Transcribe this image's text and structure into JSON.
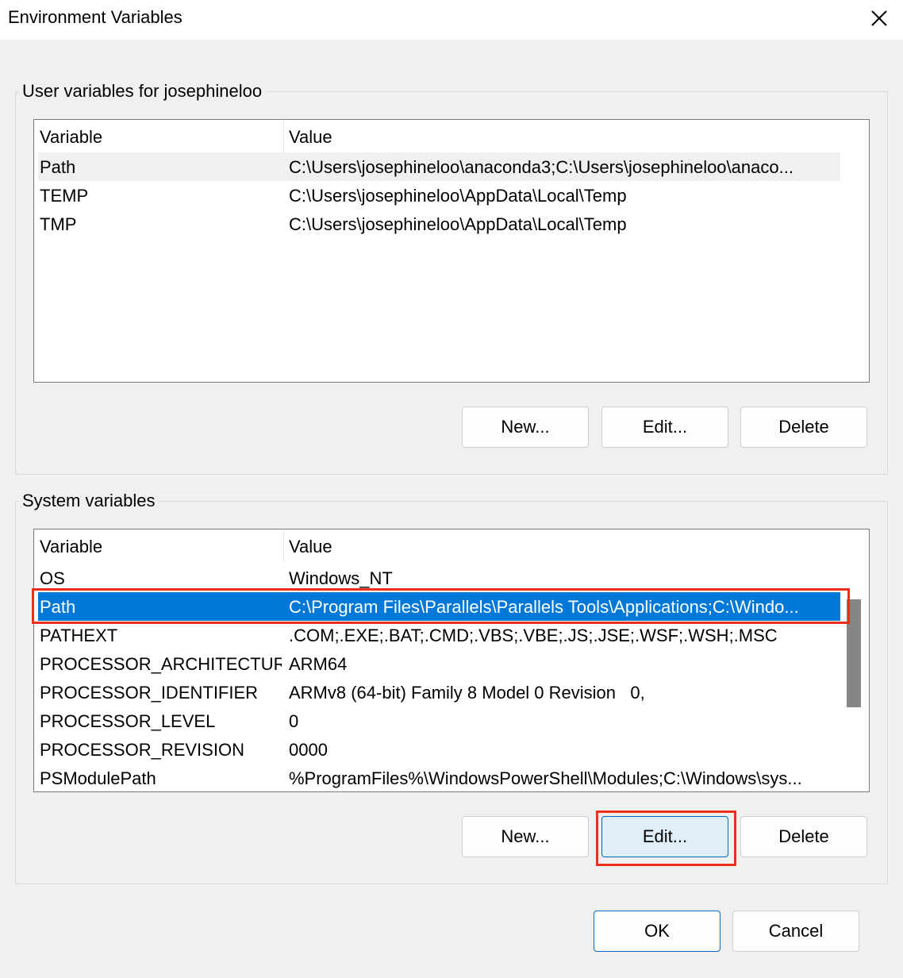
{
  "window": {
    "title": "Environment Variables"
  },
  "user_section": {
    "label": "User variables for josephineloo",
    "columns": [
      "Variable",
      "Value"
    ],
    "rows": [
      {
        "variable": "Path",
        "value": "C:\\Users\\josephineloo\\anaconda3;C:\\Users\\josephineloo\\anaco..."
      },
      {
        "variable": "TEMP",
        "value": "C:\\Users\\josephineloo\\AppData\\Local\\Temp"
      },
      {
        "variable": "TMP",
        "value": "C:\\Users\\josephineloo\\AppData\\Local\\Temp"
      }
    ],
    "buttons": {
      "new": "New...",
      "edit": "Edit...",
      "delete": "Delete"
    }
  },
  "system_section": {
    "label": "System variables",
    "columns": [
      "Variable",
      "Value"
    ],
    "rows": [
      {
        "variable": "OS",
        "value": "Windows_NT"
      },
      {
        "variable": "Path",
        "value": "C:\\Program Files\\Parallels\\Parallels Tools\\Applications;C:\\Windo..."
      },
      {
        "variable": "PATHEXT",
        "value": ".COM;.EXE;.BAT;.CMD;.VBS;.VBE;.JS;.JSE;.WSF;.WSH;.MSC"
      },
      {
        "variable": "PROCESSOR_ARCHITECTURE",
        "value": "ARM64"
      },
      {
        "variable": "PROCESSOR_IDENTIFIER",
        "value": "ARMv8 (64-bit) Family 8 Model 0 Revision   0,"
      },
      {
        "variable": "PROCESSOR_LEVEL",
        "value": "0"
      },
      {
        "variable": "PROCESSOR_REVISION",
        "value": "0000"
      },
      {
        "variable": "PSModulePath",
        "value": "%ProgramFiles%\\WindowsPowerShell\\Modules;C:\\Windows\\sys..."
      }
    ],
    "selected_row": "Path",
    "buttons": {
      "new": "New...",
      "edit": "Edit...",
      "delete": "Delete"
    }
  },
  "footer": {
    "ok": "OK",
    "cancel": "Cancel"
  },
  "colors": {
    "selection": "#0078d7",
    "annotation": "#e8311a",
    "focus_border": "#0067c0"
  },
  "icons": {
    "close": "close-icon"
  }
}
